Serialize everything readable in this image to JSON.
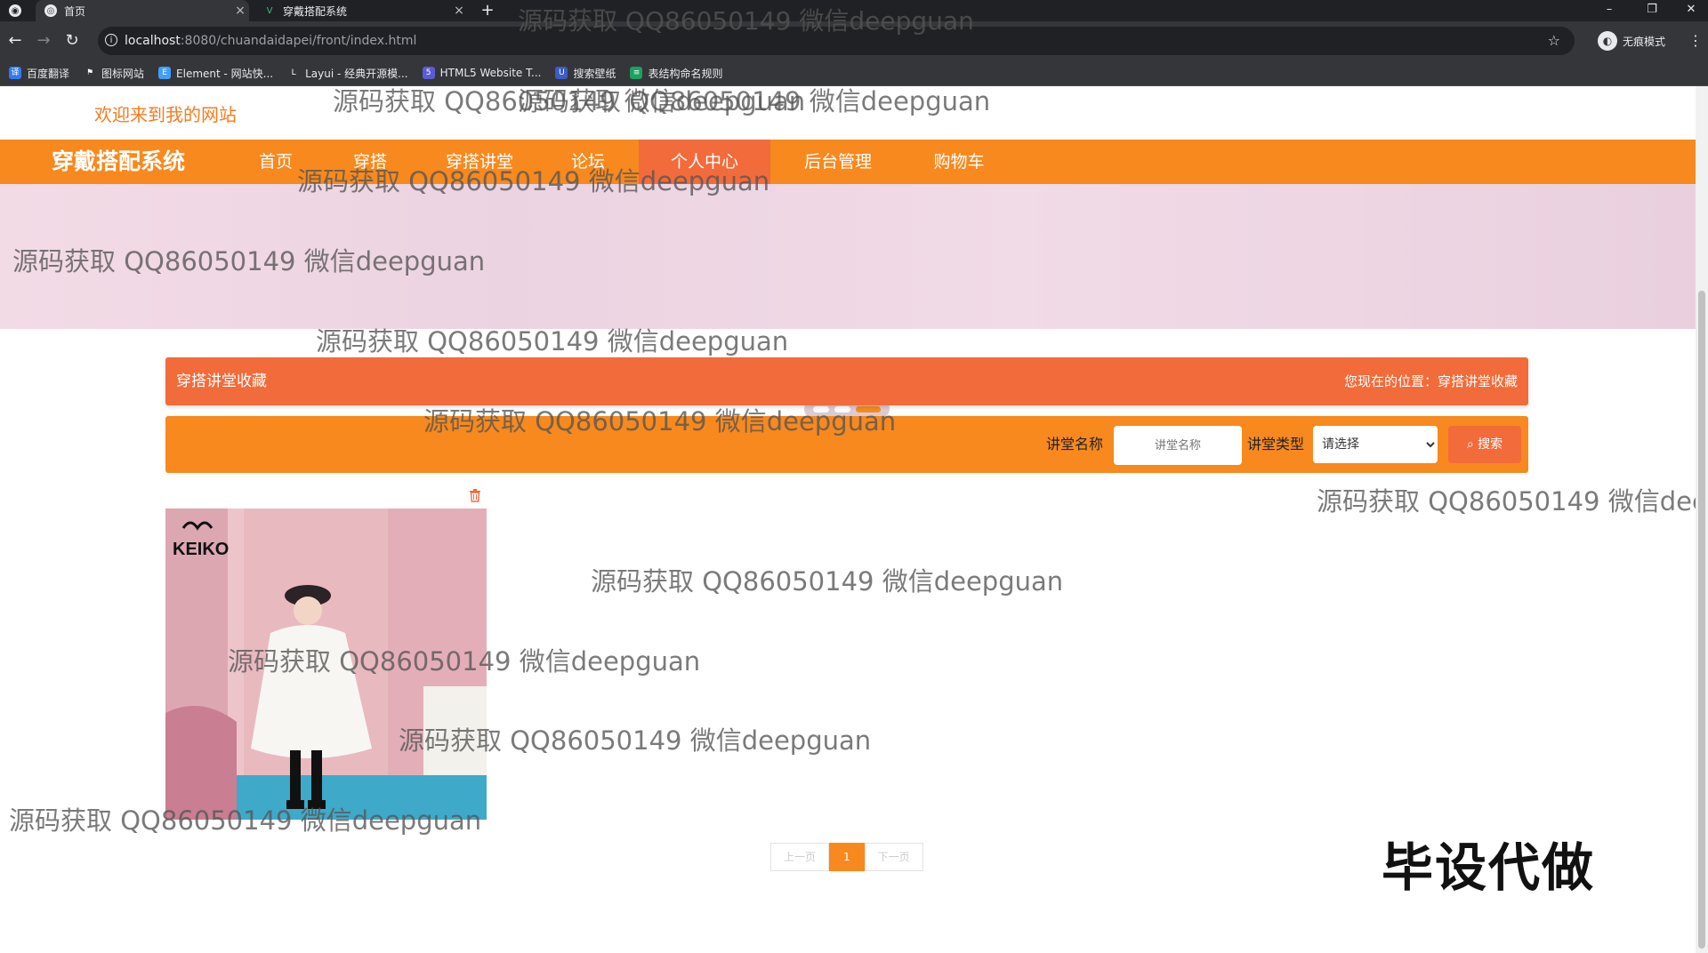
{
  "browser": {
    "tabs": [
      {
        "title": "首页",
        "active": true
      },
      {
        "title": "穿戴搭配系统",
        "active": false
      }
    ],
    "new_tab": "+",
    "url_host": "localhost",
    "url_path": ":8080/chuandaidapei/front/index.html",
    "profile_label": "无痕模式",
    "bookmarks": [
      {
        "label": "百度翻译",
        "icon": "translate-icon",
        "color": "#2d7cf6"
      },
      {
        "label": "图标网站",
        "icon": "flag-icon",
        "color": "#35363a"
      },
      {
        "label": "Element - 网站快...",
        "icon": "element-icon",
        "color": "#409eff"
      },
      {
        "label": "Layui - 经典开源模...",
        "icon": "layui-icon",
        "color": "#35363a"
      },
      {
        "label": "HTML5 Website T...",
        "icon": "html5-icon",
        "color": "#5b5bd6"
      },
      {
        "label": "搜索壁纸",
        "icon": "wallpaper-icon",
        "color": "#3b5cc9"
      },
      {
        "label": "表结构命名规则",
        "icon": "table-icon",
        "color": "#1aa260"
      }
    ]
  },
  "page": {
    "welcome": "欢迎来到我的网站",
    "brand": "穿戴搭配系统",
    "nav": [
      "首页",
      "穿搭",
      "穿搭讲堂",
      "论坛",
      "个人中心",
      "后台管理",
      "购物车"
    ],
    "active_nav": "个人中心",
    "section_title": "穿搭讲堂收藏",
    "breadcrumb": "您现在的位置：穿搭讲堂收藏",
    "search": {
      "name_label": "讲堂名称",
      "name_placeholder": "讲堂名称",
      "type_label": "讲堂类型",
      "type_selected": "请选择",
      "button": "搜索"
    },
    "card": {
      "brand_mark": "KEIKO"
    },
    "pager": {
      "prev": "上一页",
      "current": "1",
      "next": "下一页"
    }
  },
  "watermark": "源码获取 QQ86050149 微信deepguan",
  "corner_tag": "毕设代做",
  "colors": {
    "orange": "#f7891e",
    "accent": "#f26b3a"
  }
}
